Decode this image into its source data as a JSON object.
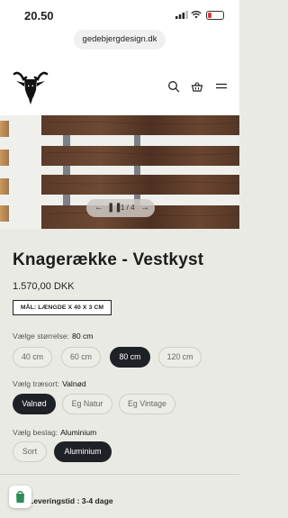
{
  "status_bar": {
    "time": "20.50"
  },
  "browser": {
    "url": "gedebjergdesign.dk"
  },
  "header": {
    "logo_icon": "goat-head-logo",
    "search_icon": "search-icon",
    "cart_icon": "basket-icon",
    "menu_icon": "hamburger-menu-icon"
  },
  "gallery": {
    "counter": "1 / 4",
    "prev_icon": "arrow-left-icon",
    "next_icon": "arrow-right-icon",
    "pause_icon": "pause-icon"
  },
  "product": {
    "title": "Knagerække - Vestkyst",
    "price": "1.570,00 DKK",
    "dimensions": "MÅL: LÆNGDE X 40 X 3 CM"
  },
  "options": {
    "size": {
      "label": "Vælge størrelse:",
      "selected": "80 cm",
      "values": [
        "40 cm",
        "60 cm",
        "80 cm",
        "120 cm"
      ]
    },
    "wood": {
      "label": "Vælg træsort:",
      "selected": "Valnød",
      "values": [
        "Valnød",
        "Eg Natur",
        "Eg Vintage"
      ]
    },
    "fitting": {
      "label": "Vælg beslag:",
      "selected": "Aluminium",
      "values": [
        "Sort",
        "Aluminium"
      ]
    }
  },
  "delivery": {
    "text": "Leveringstid : 3-4 dage"
  },
  "colors": {
    "accent": "#1e2226",
    "background": "#e9eae3",
    "battery_low": "#e53935"
  }
}
